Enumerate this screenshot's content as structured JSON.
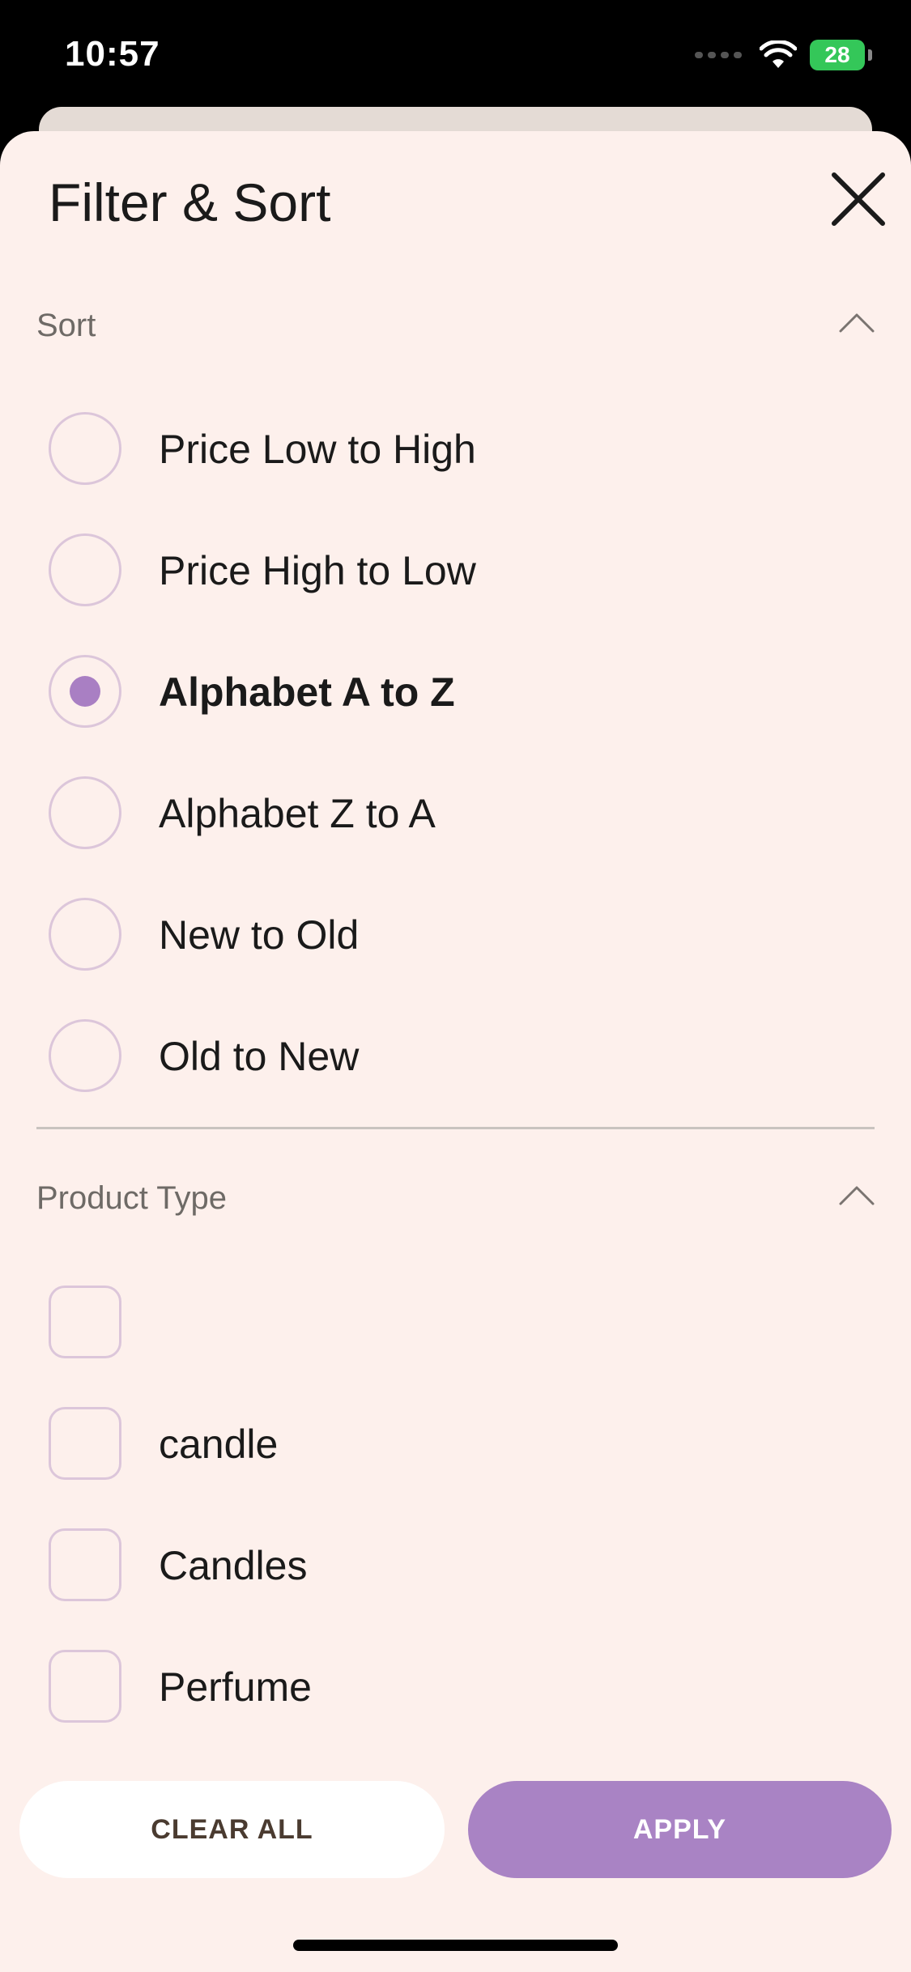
{
  "status_bar": {
    "time": "10:57",
    "battery": "28"
  },
  "sheet": {
    "title": "Filter & Sort"
  },
  "sort": {
    "label": "Sort",
    "options": [
      {
        "label": "Price Low to High",
        "selected": false
      },
      {
        "label": "Price High to Low",
        "selected": false
      },
      {
        "label": "Alphabet A to Z",
        "selected": true
      },
      {
        "label": "Alphabet Z to A",
        "selected": false
      },
      {
        "label": "New to Old",
        "selected": false
      },
      {
        "label": "Old to New",
        "selected": false
      }
    ]
  },
  "product_type": {
    "label": "Product Type",
    "options": [
      {
        "label": "",
        "checked": false
      },
      {
        "label": "candle",
        "checked": false
      },
      {
        "label": "Candles",
        "checked": false
      },
      {
        "label": "Perfume",
        "checked": false
      }
    ]
  },
  "buttons": {
    "clear_all": "CLEAR ALL",
    "apply": "APPLY"
  },
  "colors": {
    "accent": "#a983c4",
    "background": "#fdf0ec",
    "radio_border": "#dcc6da"
  },
  "icons": {
    "close": "close-icon",
    "collapse": "chevron-up-icon",
    "wifi": "wifi-icon",
    "battery": "battery-icon"
  }
}
